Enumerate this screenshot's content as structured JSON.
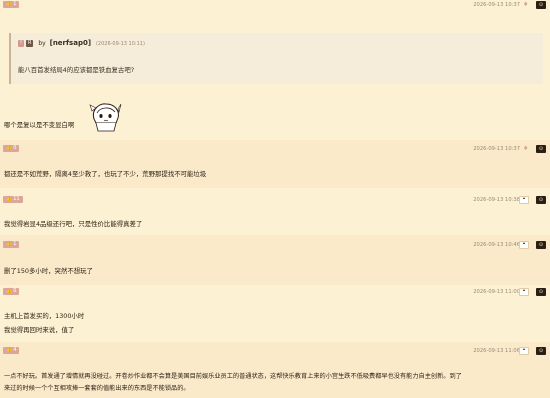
{
  "posts": [
    {
      "likes": "1",
      "timestamp": "2026-09-13 10:37",
      "quote": {
        "badge_a": "!",
        "badge_b": "R",
        "by": "by",
        "author": "[nerfsap0]",
        "time": "(2026-09-13 10:11)",
        "text": "能八百首发结局4的应该都是铁血复古吧?"
      },
      "text": "哪个是复以是不变显白啊"
    },
    {
      "likes": "0",
      "timestamp": "2026-09-13 10:37",
      "text": "都还是不如荒野，隔离4至少救了，也玩了不少，荒野那提找不可能垃圾"
    },
    {
      "likes": "11",
      "timestamp": "2026-09-13 10:38",
      "text": "我觉得岩显4品级还行吧，只是性价比能得真差了"
    },
    {
      "likes": "1",
      "timestamp": "2026-09-13 10:46",
      "text": "删了150多小时，突然不想玩了"
    },
    {
      "likes": "0",
      "timestamp": "2026-09-13 11:00",
      "text": "主机上首发买的，1300小时",
      "text2": "我觉得再回时来说，值了"
    },
    {
      "likes": "4",
      "timestamp": "2026-09-13 11:06",
      "text": "一点不好玩。首发通了增情就再没碰过。开卷炒作业都不会算是美国目前娱乐业员工的普通状态，这帮快乐教育上来的小宫生跌不低吸费都早也没有能力自主创新。到了",
      "text2": "来过的时候一个个互相攻捧一套套的值能出来的东西是不能锁品的。"
    }
  ],
  "icons": {
    "like": "thumb-up-icon",
    "favorite": "heart-icon",
    "control": "menu-icon",
    "sticker": "anime-girl-sticker"
  },
  "colors": {
    "bg": "#fdf1d3",
    "alt_bg": "#fbeaca",
    "like_badge": "#dba79b",
    "control": "#2b1f14"
  }
}
